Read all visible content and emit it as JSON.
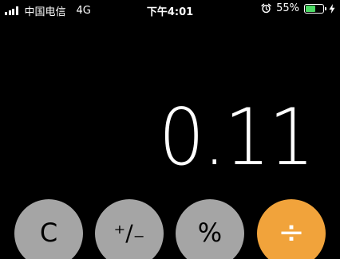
{
  "status_bar": {
    "carrier": "中国电信",
    "network": "4G",
    "time": "下午4:01",
    "battery_percent_label": "55%",
    "battery_level": 0.55,
    "battery_color": "#4cd964",
    "icons": [
      "signal-icon",
      "alarm-icon",
      "battery-icon",
      "charging-bolt-icon"
    ]
  },
  "display": {
    "value": "0.11"
  },
  "keypad": {
    "clear_label": "C",
    "sign_label": "⁺∕₋",
    "percent_label": "%",
    "divide_label": "÷"
  },
  "colors": {
    "background": "#000000",
    "function_key": "#a5a5a5",
    "operator_key": "#f1a33b",
    "display_text": "#ffffff"
  }
}
